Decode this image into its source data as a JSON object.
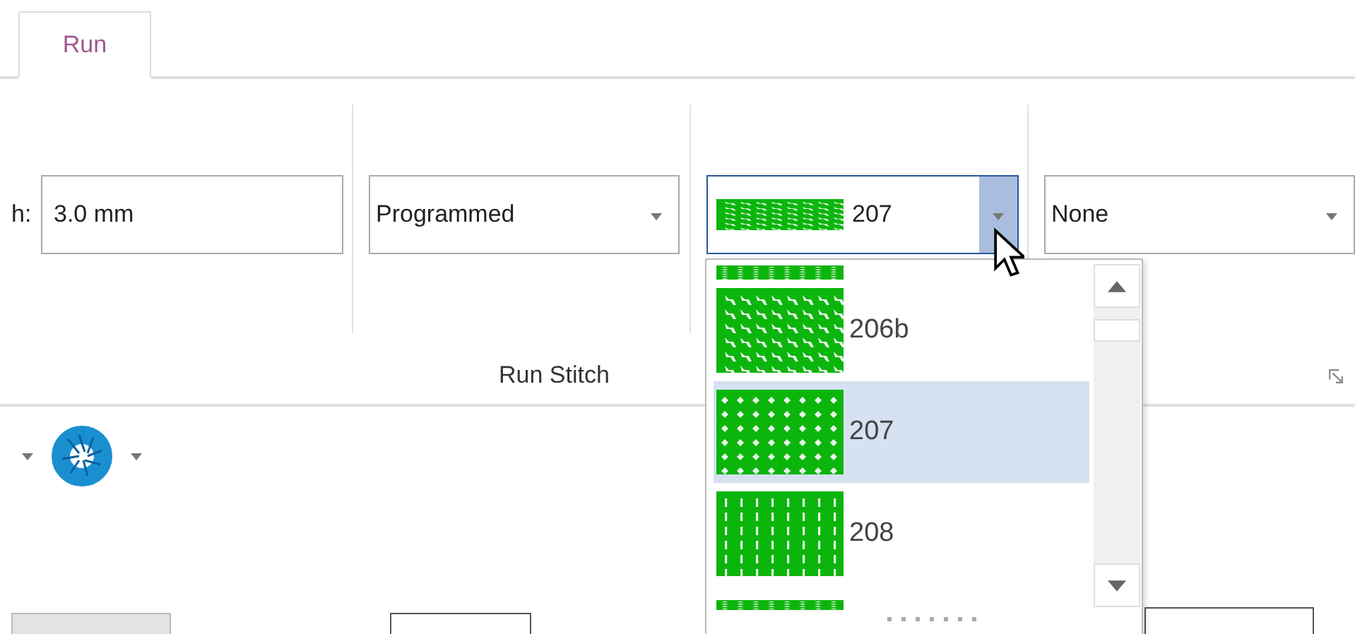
{
  "tabs": [
    {
      "label": "Run",
      "selected": true
    }
  ],
  "ribbon": {
    "length_field": {
      "label": "h:",
      "value": "3.0 mm"
    },
    "type_dropdown": {
      "value": "Programmed"
    },
    "pattern_combo": {
      "value": "207",
      "open": true
    },
    "option_dropdown": {
      "value": "None"
    },
    "group_label": "Run Stitch"
  },
  "pattern_list": {
    "items": [
      {
        "kind": "partial",
        "selected": false
      },
      {
        "kind": "item",
        "label": "206b",
        "selected": false
      },
      {
        "kind": "item",
        "label": "207",
        "selected": true
      },
      {
        "kind": "item",
        "label": "208",
        "selected": false
      },
      {
        "kind": "partial",
        "selected": false
      }
    ]
  }
}
